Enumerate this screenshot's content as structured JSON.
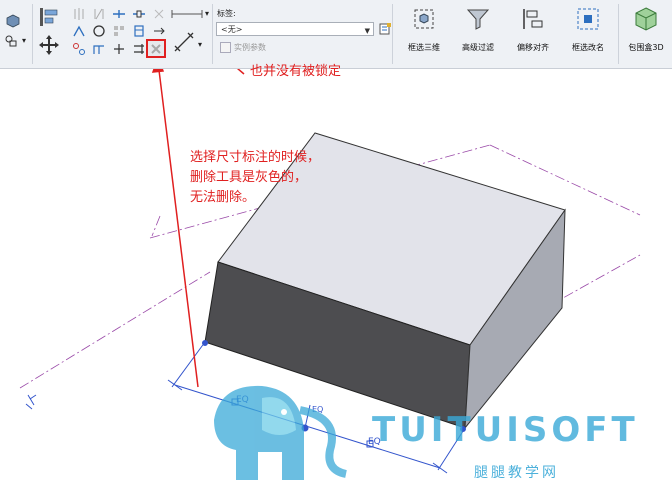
{
  "ribbon": {
    "label_field": "标签:",
    "combo_value": "<无>",
    "instance_param": "实例参数",
    "big_buttons": [
      {
        "label": "框选三维"
      },
      {
        "label": "高级过滤"
      },
      {
        "label": "偏移对齐"
      },
      {
        "label": "框选改名"
      },
      {
        "label": "包围盒3D"
      }
    ]
  },
  "annotations": {
    "lock_note": "也并没有被锁定",
    "delete_note_line1": "选择尺寸标注的时候，",
    "delete_note_line2": "删除工具是灰色的，",
    "delete_note_line3": "无法删除。"
  },
  "dimension": {
    "eq_left": "EQ",
    "eq_mid": "EQ",
    "eq_right": "EQ"
  },
  "watermark": {
    "brand": "TUITUISOFT",
    "sub": "腿腿教学网"
  },
  "colors": {
    "annotation": "#e02020",
    "dimension": "#3355cc",
    "ribbon_bg": "#eef1f5",
    "watermark": "#3aa9d8"
  }
}
